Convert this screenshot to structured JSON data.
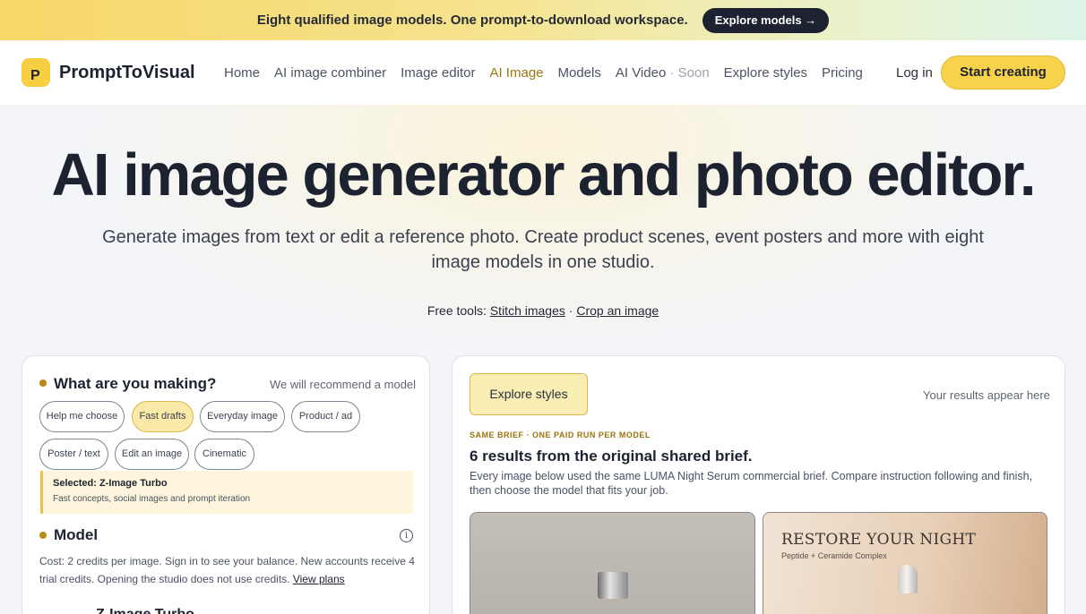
{
  "announcement": {
    "text": "Eight qualified image models. One prompt-to-download workspace.",
    "button": "Explore models →"
  },
  "header": {
    "logo_letter": "P",
    "brand": "PromptToVisual",
    "nav": [
      "Home",
      "AI image combiner",
      "Image editor",
      "AI Image",
      "Models",
      "AI Video",
      "Explore styles",
      "Pricing"
    ],
    "nav_soon": "· Soon",
    "active_item": "AI Image",
    "login": "Log in",
    "cta": "Start creating"
  },
  "hero": {
    "title": "AI image generator and photo editor.",
    "subtitle": "Generate images from text or edit a reference photo. Create product scenes, event posters and more with eight image models in one studio.",
    "free_tools_label": "Free tools:",
    "free_tools_links": [
      "Stitch images",
      "Crop an image"
    ],
    "free_tools_sep": "·"
  },
  "left_card": {
    "making_title": "What are you making?",
    "making_hint": "We will recommend a model",
    "chips": [
      "Help me choose",
      "Fast drafts",
      "Everyday image",
      "Product / ad",
      "Poster / text",
      "Edit an image",
      "Cinematic"
    ],
    "selected_chip": "Fast drafts",
    "selected_title": "Selected: Z-Image Turbo",
    "selected_desc": "Fast concepts, social images and prompt iteration",
    "model_title": "Model",
    "info_icon": "i",
    "cost_text": "Cost: 2 credits per image. Sign in to see your balance. New accounts receive 4 trial credits. Opening the studio does not use credits.",
    "view_plans": "View plans",
    "model_name": "Z-Image Turbo"
  },
  "right_card": {
    "explore_button": "Explore styles",
    "results_hint": "Your results appear here",
    "eyebrow": "SAME BRIEF · ONE PAID RUN PER MODEL",
    "title": "6 results from the original shared brief.",
    "description": "Every image below used the same LUMA Night Serum commercial brief. Compare instruction following and finish, then choose the model that fits your job.",
    "image_b_headline": "RESTORE YOUR NIGHT",
    "image_b_sub": "Peptide + Ceramide Complex"
  },
  "colors": {
    "accent": "#f8d24a",
    "active_nav": "#9a7410",
    "dark": "#1c2230"
  }
}
